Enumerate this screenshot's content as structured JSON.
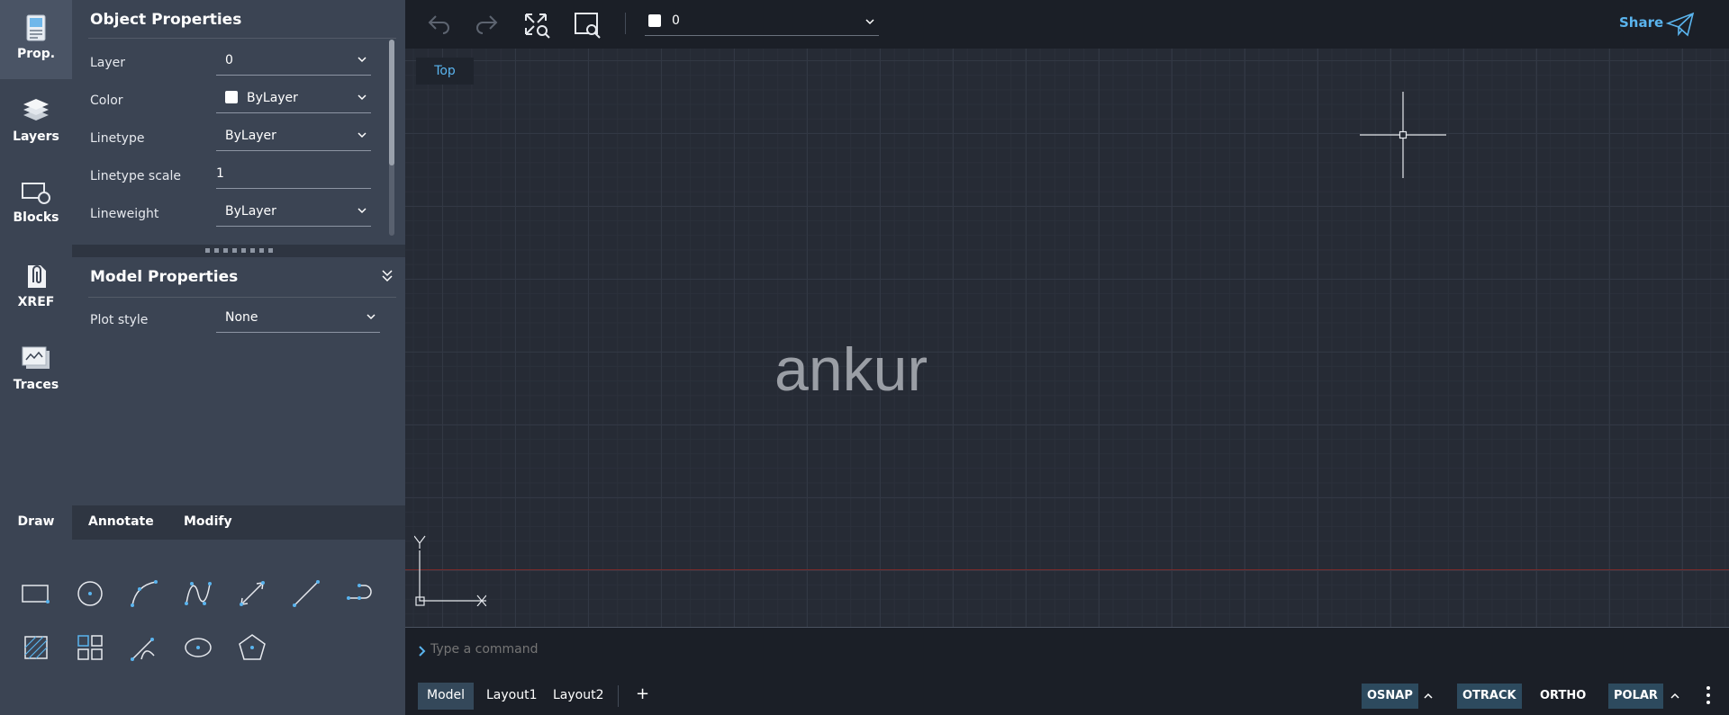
{
  "rail": {
    "items": [
      {
        "label": "Prop."
      },
      {
        "label": "Layers"
      },
      {
        "label": "Blocks"
      },
      {
        "label": "XREF"
      },
      {
        "label": "Traces"
      }
    ]
  },
  "object_properties": {
    "title": "Object Properties",
    "rows": [
      {
        "label": "Layer",
        "value": "0"
      },
      {
        "label": "Color",
        "value": "ByLayer"
      },
      {
        "label": "Linetype",
        "value": "ByLayer"
      },
      {
        "label": "Linetype scale",
        "value": "1"
      },
      {
        "label": "Lineweight",
        "value": "ByLayer"
      }
    ]
  },
  "model_properties": {
    "title": "Model Properties",
    "rows": [
      {
        "label": "Plot style",
        "value": "None"
      }
    ]
  },
  "draw_panel": {
    "tabs": [
      {
        "label": "Draw"
      },
      {
        "label": "Annotate"
      },
      {
        "label": "Modify"
      }
    ]
  },
  "toolbar": {
    "layer_value": "0",
    "share_label": "Share"
  },
  "canvas": {
    "view_label": "Top",
    "drawing_text": "ankur",
    "axis_y": "Y"
  },
  "command": {
    "placeholder": "Type a command"
  },
  "layouts": {
    "tabs": [
      {
        "label": "Model"
      },
      {
        "label": "Layout1"
      },
      {
        "label": "Layout2"
      }
    ],
    "add_label": "+"
  },
  "status": {
    "osnap": "OSNAP",
    "otrack": "OTRACK",
    "ortho": "ORTHO",
    "polar": "POLAR"
  },
  "colors": {
    "accent": "#5ab4ee",
    "panel": "#3b4453",
    "canvas": "#262b35"
  }
}
